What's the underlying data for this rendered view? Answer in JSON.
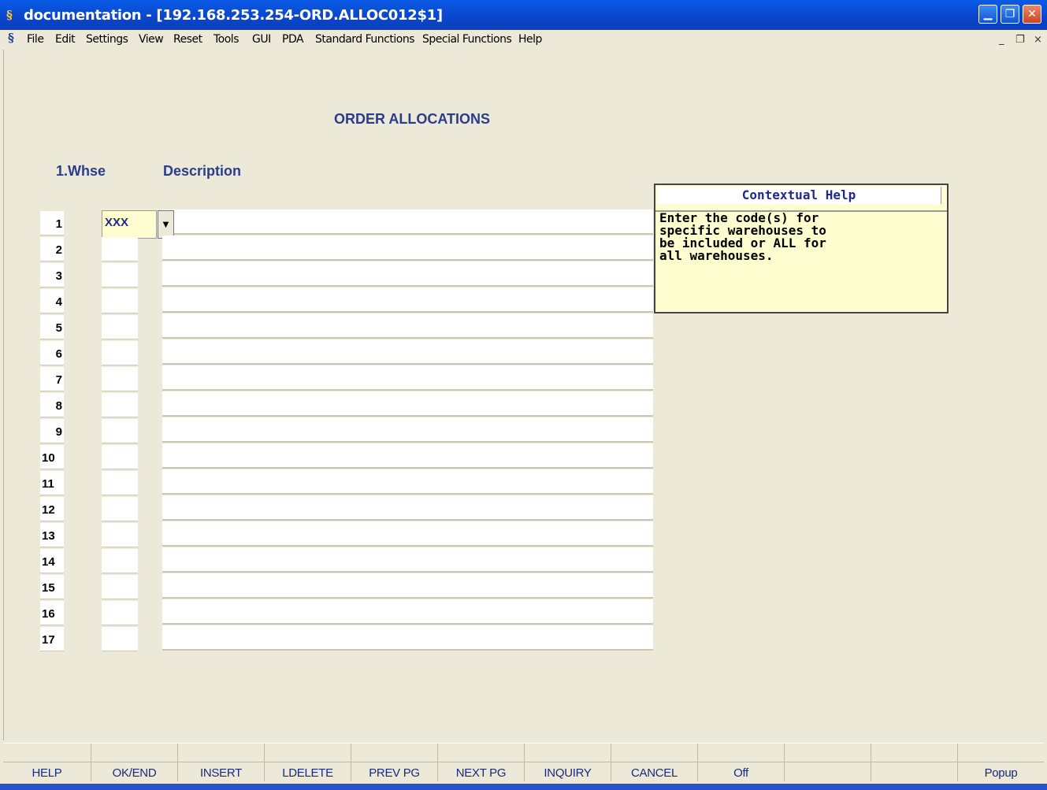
{
  "window": {
    "title": "documentation - [192.168.253.254-ORD.ALLOC012$1]",
    "app_icon": "sh-logo-icon",
    "controls": [
      "minimize",
      "maximize",
      "close"
    ]
  },
  "menu": {
    "items": [
      "File",
      "Edit",
      "Settings",
      "View",
      "Reset",
      "Tools",
      "GUI",
      "PDA",
      "Standard Functions",
      "Special Functions",
      "Help"
    ],
    "mdi_controls": [
      "_",
      "Б",
      "×"
    ]
  },
  "screen": {
    "title": "ORDER ALLOCATIONS",
    "col_whse": "1.Whse",
    "col_desc": "Description"
  },
  "rows": [
    {
      "num": "1",
      "whse": "XXX",
      "desc": ""
    },
    {
      "num": "2",
      "whse": "",
      "desc": ""
    },
    {
      "num": "3",
      "whse": "",
      "desc": ""
    },
    {
      "num": "4",
      "whse": "",
      "desc": ""
    },
    {
      "num": "5",
      "whse": "",
      "desc": ""
    },
    {
      "num": "6",
      "whse": "",
      "desc": ""
    },
    {
      "num": "7",
      "whse": "",
      "desc": ""
    },
    {
      "num": "8",
      "whse": "",
      "desc": ""
    },
    {
      "num": "9",
      "whse": "",
      "desc": ""
    },
    {
      "num": "10",
      "whse": "",
      "desc": ""
    },
    {
      "num": "11",
      "whse": "",
      "desc": ""
    },
    {
      "num": "12",
      "whse": "",
      "desc": ""
    },
    {
      "num": "13",
      "whse": "",
      "desc": ""
    },
    {
      "num": "14",
      "whse": "",
      "desc": ""
    },
    {
      "num": "15",
      "whse": "",
      "desc": ""
    },
    {
      "num": "16",
      "whse": "",
      "desc": ""
    },
    {
      "num": "17",
      "whse": "",
      "desc": ""
    }
  ],
  "help": {
    "title": "Contextual Help",
    "text": "Enter the code(s) for\nspecific warehouses to\nbe included or ALL for\nall warehouses."
  },
  "fkeys": [
    "HELP",
    "OK/END",
    "INSERT",
    "LDELETE",
    "PREV PG",
    "NEXT PG",
    "INQUIRY",
    "CANCEL",
    "Off",
    "",
    "",
    "Popup"
  ],
  "colors": {
    "title_blue": "#2a3c8e",
    "fkey_blue": "#1b2a7a",
    "field_yellow": "#fefdcf",
    "bg": "#ece9d8"
  }
}
